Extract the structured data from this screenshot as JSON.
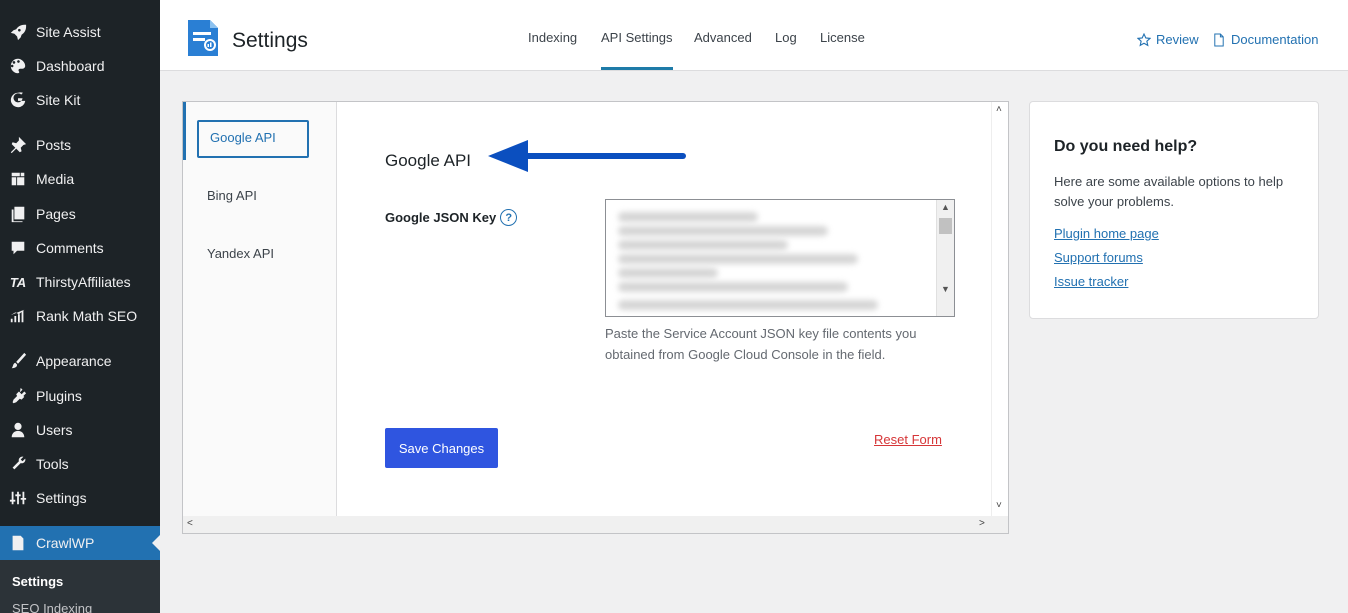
{
  "sidebar": {
    "items": [
      {
        "label": "Site Assist",
        "icon": "rocket-icon"
      },
      {
        "label": "Dashboard",
        "icon": "palette-icon"
      },
      {
        "label": "Site Kit",
        "icon": "google-g-icon"
      },
      {
        "label": "Posts",
        "icon": "pushpin-icon"
      },
      {
        "label": "Media",
        "icon": "media-icon"
      },
      {
        "label": "Pages",
        "icon": "pages-icon"
      },
      {
        "label": "Comments",
        "icon": "comment-icon"
      },
      {
        "label": "ThirstyAffiliates",
        "icon": "ta-icon",
        "icon_text": "TA"
      },
      {
        "label": "Rank Math SEO",
        "icon": "chart-icon"
      },
      {
        "label": "Appearance",
        "icon": "brush-icon"
      },
      {
        "label": "Plugins",
        "icon": "plug-icon"
      },
      {
        "label": "Users",
        "icon": "user-icon"
      },
      {
        "label": "Tools",
        "icon": "wrench-icon"
      },
      {
        "label": "Settings",
        "icon": "sliders-icon"
      },
      {
        "label": "CrawlWP",
        "icon": "crawlwp-icon"
      }
    ],
    "submenu": [
      "Settings",
      "SEO Indexing"
    ]
  },
  "header": {
    "title": "Settings",
    "tabs": [
      "Indexing",
      "API Settings",
      "Advanced",
      "Log",
      "License"
    ],
    "active_tab": "API Settings",
    "review_label": "Review",
    "docs_label": "Documentation"
  },
  "panel": {
    "vtabs": [
      "Google API",
      "Bing API",
      "Yandex API"
    ],
    "section_title": "Google API",
    "field_label": "Google JSON Key",
    "help_glyph": "?",
    "field_description": "Paste the Service Account JSON key file contents you obtained from Google Cloud Console in the field.",
    "save_label": "Save Changes",
    "reset_label": "Reset Form"
  },
  "help": {
    "title": "Do you need help?",
    "text": "Here are some available options to help solve your problems.",
    "links": [
      "Plugin home page",
      "Support forums",
      "Issue tracker"
    ]
  },
  "colors": {
    "sidebar_bg": "#1d2327",
    "active_bg": "#2271b1",
    "primary_button": "#2f55e0",
    "link": "#2271b1",
    "danger": "#d63638",
    "arrow": "#0b4fbf"
  }
}
